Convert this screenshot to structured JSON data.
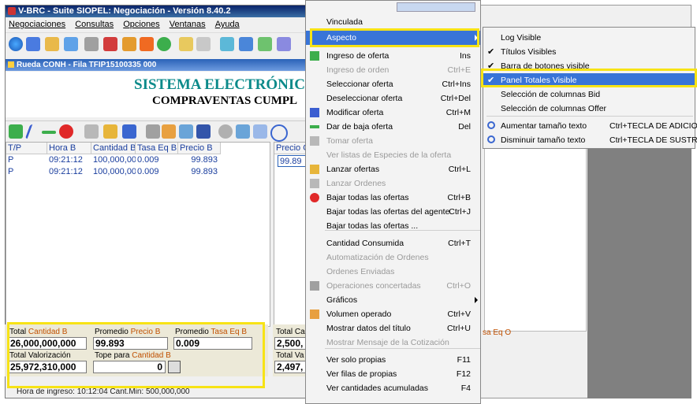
{
  "window": {
    "title": "V-BRC - Suite SIOPEL: Negociación - Versión 8.40.2",
    "menubar": [
      "Negociaciones",
      "Consultas",
      "Opciones",
      "Ventanas",
      "Ayuda"
    ],
    "sub_title": "Rueda CONH - Fila TFIP15100335 000",
    "banner_line1": "SISTEMA ELECTRÓNICO I",
    "banner_line2": "COMPRAVENTAS CUMPL"
  },
  "grid": {
    "headers": [
      "T/P",
      "Hora B",
      "Cantidad B",
      "Tasa Eq B",
      "Precio B"
    ],
    "rows": [
      [
        "P",
        "09:21:12",
        "100,000,000",
        "0.009",
        "99.893"
      ],
      [
        "P",
        "09:21:12",
        "100,000,000",
        "0.009",
        "99.893"
      ]
    ],
    "right_header": "Precio C",
    "right_value": "99.89"
  },
  "totals": {
    "total_label": "Total",
    "cantidad_label": "Cantidad B",
    "cantidad_value": "26,000,000,000",
    "promedio_label": "Promedio",
    "precio_label": "Precio B",
    "precio_value": "99.893",
    "promedio2_label": "Promedio",
    "tasa_label": "Tasa Eq B",
    "tasa_value": "0.009",
    "valorizacion_total": "Total",
    "valorizacion_label": "Valorización",
    "valorizacion_value": "25,972,310,000",
    "tope_label": "Tope para",
    "tope_cantidad": "Cantidad B",
    "tope_value": "0",
    "right_total1": "Total Ca",
    "right_val1": "2,500,",
    "right_total2": "Total Va",
    "right_val2": "2,497,",
    "right_tasa": "sa Eq O"
  },
  "statusbar": {
    "text": "Hora de ingreso: 10:12:04   Cant.Min: 500,000,000"
  },
  "context_menu": {
    "items": [
      {
        "label": "Vinculada",
        "shortcut": "",
        "disabled": false
      },
      {
        "label": "Aspecto",
        "shortcut": "",
        "disabled": false,
        "selected": true,
        "submenu": true
      },
      {
        "label": "Ingreso de oferta",
        "shortcut": "Ins",
        "disabled": false,
        "icon": "plus-icon"
      },
      {
        "label": "Ingreso de orden",
        "shortcut": "Ctrl+E",
        "disabled": true
      },
      {
        "label": "Seleccionar oferta",
        "shortcut": "Ctrl+Ins",
        "disabled": false
      },
      {
        "label": "Deseleccionar oferta",
        "shortcut": "Ctrl+Del",
        "disabled": false
      },
      {
        "label": "Modificar oferta",
        "shortcut": "Ctrl+M",
        "disabled": false,
        "icon": "pencil-icon"
      },
      {
        "label": "Dar de baja oferta",
        "shortcut": "Del",
        "disabled": false,
        "icon": "minus-icon"
      },
      {
        "label": "Tomar oferta",
        "shortcut": "",
        "disabled": true,
        "icon": "hand-icon"
      },
      {
        "label": "Ver listas de Especies de la oferta",
        "shortcut": "",
        "disabled": true
      },
      {
        "label": "Lanzar ofertas",
        "shortcut": "Ctrl+L",
        "disabled": false,
        "icon": "launch-icon"
      },
      {
        "label": "Lanzar Ordenes",
        "shortcut": "",
        "disabled": true,
        "icon": "launch-gray-icon"
      },
      {
        "label": "Bajar todas las ofertas",
        "shortcut": "Ctrl+B",
        "disabled": false,
        "icon": "stop-icon"
      },
      {
        "label": "Bajar todas las ofertas del agente",
        "shortcut": "Ctrl+J",
        "disabled": false
      },
      {
        "label": "Bajar todas las ofertas ...",
        "shortcut": "",
        "disabled": false
      },
      {
        "label": "Cantidad Consumida",
        "shortcut": "Ctrl+T",
        "disabled": false
      },
      {
        "label": "Automatización de Ordenes",
        "shortcut": "",
        "disabled": true
      },
      {
        "label": "Ordenes Enviadas",
        "shortcut": "",
        "disabled": true
      },
      {
        "label": "Operaciones concertadas",
        "shortcut": "Ctrl+O",
        "disabled": true,
        "icon": "square-icon"
      },
      {
        "label": "Gráficos",
        "shortcut": "",
        "disabled": false,
        "submenu": true
      },
      {
        "label": "Volumen operado",
        "shortcut": "Ctrl+V",
        "disabled": false,
        "icon": "volume-icon"
      },
      {
        "label": "Mostrar datos del título",
        "shortcut": "Ctrl+U",
        "disabled": false
      },
      {
        "label": "Mostrar Mensaje de la Cotización",
        "shortcut": "",
        "disabled": true
      },
      {
        "label": "Ver solo propias",
        "shortcut": "F11",
        "disabled": false
      },
      {
        "label": "Ver filas de propias",
        "shortcut": "F12",
        "disabled": false
      },
      {
        "label": "Ver cantidades acumuladas",
        "shortcut": "F4",
        "disabled": false
      }
    ]
  },
  "submenu": {
    "items": [
      {
        "label": "Log Visible",
        "check": false,
        "shortcut": ""
      },
      {
        "label": "Títulos Visibles",
        "check": true,
        "shortcut": ""
      },
      {
        "label": "Barra de botones visible",
        "check": true,
        "shortcut": ""
      },
      {
        "label": "Panel Totales Visible",
        "check": true,
        "shortcut": "",
        "selected": true
      },
      {
        "label": "Selección de columnas Bid",
        "check": false,
        "shortcut": ""
      },
      {
        "label": "Selección de columnas Offer",
        "check": false,
        "shortcut": ""
      },
      {
        "label": "Aumentar tamaño texto",
        "check": false,
        "shortcut": "Ctrl+TECLA DE ADICION",
        "icon": "zoom-in-icon"
      },
      {
        "label": "Disminuir tamaño texto",
        "check": false,
        "shortcut": "Ctrl+TECLA DE SUSTRACCION",
        "icon": "zoom-out-icon"
      }
    ]
  },
  "colors": {
    "highlight": "#f7e315",
    "selection": "#3874d8",
    "banner_text": "#0b8a8a"
  }
}
